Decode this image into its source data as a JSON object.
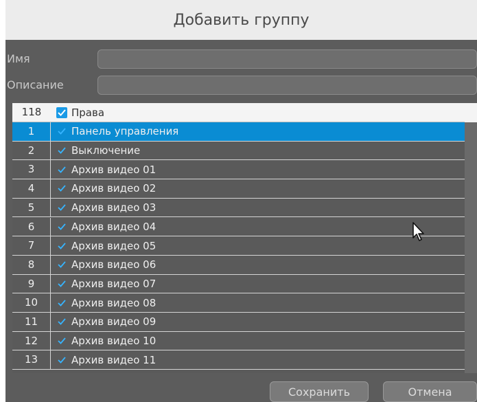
{
  "dialog": {
    "title": "Добавить группу",
    "name_label": "Имя",
    "name_value": "",
    "description_label": "Описание",
    "description_value": ""
  },
  "rights": {
    "header": {
      "count": "118",
      "label": "Права"
    },
    "items": [
      {
        "num": "1",
        "label": "Панель управления",
        "checked": true,
        "selected": true
      },
      {
        "num": "2",
        "label": "Выключение",
        "checked": true
      },
      {
        "num": "3",
        "label": "Архив видео 01",
        "checked": true
      },
      {
        "num": "4",
        "label": "Архив видео 02",
        "checked": true
      },
      {
        "num": "5",
        "label": "Архив видео 03",
        "checked": true
      },
      {
        "num": "6",
        "label": "Архив видео 04",
        "checked": true
      },
      {
        "num": "7",
        "label": "Архив видео 05",
        "checked": true
      },
      {
        "num": "8",
        "label": "Архив видео 06",
        "checked": true
      },
      {
        "num": "9",
        "label": "Архив видео 07",
        "checked": true
      },
      {
        "num": "10",
        "label": "Архив видео 08",
        "checked": true
      },
      {
        "num": "11",
        "label": "Архив видео 09",
        "checked": true
      },
      {
        "num": "12",
        "label": "Архив видео 10",
        "checked": true
      },
      {
        "num": "13",
        "label": "Архив видео 11",
        "checked": true
      }
    ]
  },
  "buttons": {
    "save": "Сохранить",
    "cancel": "Отмена"
  },
  "colors": {
    "selected_row": "#0a8cd3",
    "checkbox": "#1a9ae6",
    "panel": "#5c5c5c"
  },
  "icons": {
    "check": "checkmark-icon",
    "pointer": "mouse-pointer-icon"
  }
}
